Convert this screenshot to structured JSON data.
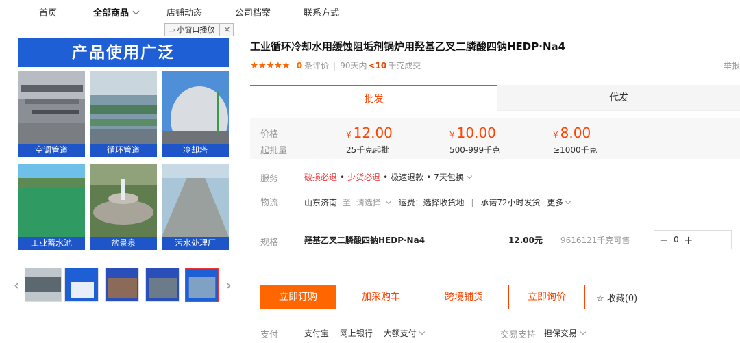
{
  "nav": {
    "items": [
      "首页",
      "全部商品",
      "店铺动态",
      "公司档案",
      "联系方式"
    ]
  },
  "mini_window": {
    "label": "小窗口播放",
    "close": "×"
  },
  "gallery": {
    "banner": "产品使用广泛",
    "tiles": [
      "空调管道",
      "循环管道",
      "冷却塔",
      "工业蓄水池",
      "盆景泉",
      "污水处理厂"
    ]
  },
  "product": {
    "title": "工业循环冷却水用缓蚀阻垢剂锅炉用羟基乙叉二膦酸四钠HEDP·Na4",
    "rating": {
      "stars": "★★★★★",
      "count": "0",
      "count_label": "条评价",
      "period": "90天内",
      "lt": "<10",
      "deal_label": "千克成交"
    },
    "report": "举报"
  },
  "tabs": [
    "批发",
    "代发"
  ],
  "pricing": {
    "price_label": "价格",
    "moq_label": "起批量",
    "currency": "¥",
    "tiers": [
      {
        "price": "12.00",
        "moq": "25千克起批"
      },
      {
        "price": "10.00",
        "moq": "500-999千克"
      },
      {
        "price": "8.00",
        "moq": "≥1000千克"
      }
    ]
  },
  "service": {
    "label": "服务",
    "red_items": [
      "破损必退",
      "少货必退"
    ],
    "items": [
      "极速退款",
      "7天包换"
    ]
  },
  "logistics": {
    "label": "物流",
    "origin": "山东济南",
    "to": "至",
    "select": "请选择",
    "freight": "运费：选择收货地",
    "promise": "承诺72小时发货",
    "more": "更多"
  },
  "spec": {
    "label": "规格",
    "name": "羟基乙叉二膦酸四钠HEDP·Na4",
    "price": "12.00元",
    "stock": "9616121千克可售",
    "qty": "0",
    "minus": "−",
    "plus": "+"
  },
  "actions": {
    "buy": "立即订购",
    "cart": "加采购车",
    "crossborder": "跨境铺货",
    "inquiry": "立即询价",
    "favorite": "☆ 收藏(0)"
  },
  "payment": {
    "label": "支付",
    "methods": [
      "支付宝",
      "网上银行",
      "大额支付"
    ],
    "trade_label": "交易支持",
    "trade_value": "担保交易"
  },
  "colors": {
    "accent": "#ff6600",
    "banner": "#1f5fd6"
  }
}
